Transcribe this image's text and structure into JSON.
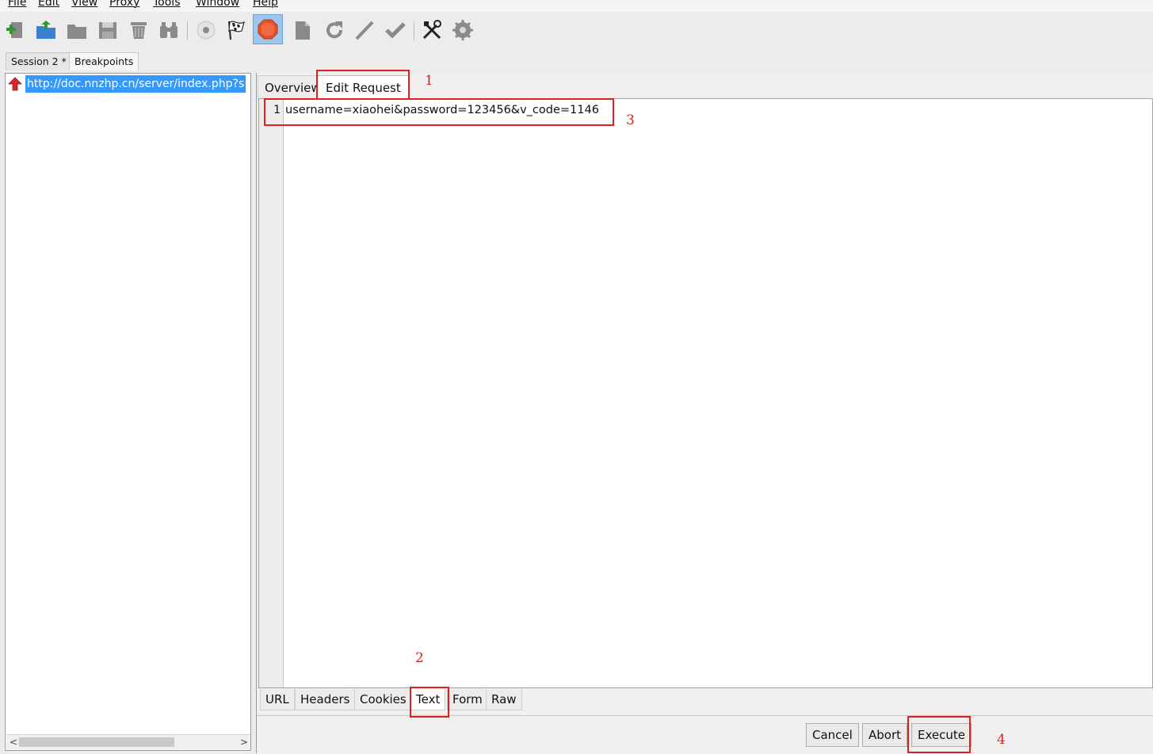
{
  "menu": [
    "File",
    "Edit",
    "View",
    "Proxy",
    "Tools",
    "Window",
    "Help"
  ],
  "toolbar": {
    "icons": [
      "new-session-icon",
      "open-folder-icon",
      "folder-icon",
      "save-icon",
      "trash-icon",
      "find-binoculars-icon",
      "record-icon",
      "start-flag-icon",
      "stop-breakpoint-icon",
      "edit-document-icon",
      "repeat-icon",
      "validate-icon",
      "checkmark-icon",
      "tools-icon",
      "settings-gear-icon"
    ],
    "active_icon": "stop-breakpoint-icon",
    "active_color": "#e8502a"
  },
  "session_tabs": [
    "Session 2 *",
    "Breakpoints"
  ],
  "tree": {
    "selected_url": "http://doc.nnzhp.cn/server/index.php?s"
  },
  "request_tabs": [
    "Overview",
    "Edit Request"
  ],
  "editor": {
    "line_number": "1",
    "content": "username=xiaohei&password=123456&v_code=1146"
  },
  "bottom_tabs": [
    "URL",
    "Headers",
    "Cookies",
    "Text",
    "Form",
    "Raw"
  ],
  "actions": {
    "cancel": "Cancel",
    "abort": "Abort",
    "execute": "Execute"
  },
  "annotations": [
    "1",
    "2",
    "3",
    "4"
  ],
  "colors": {
    "annotation": "#e02020",
    "selection": "#3399ff"
  }
}
